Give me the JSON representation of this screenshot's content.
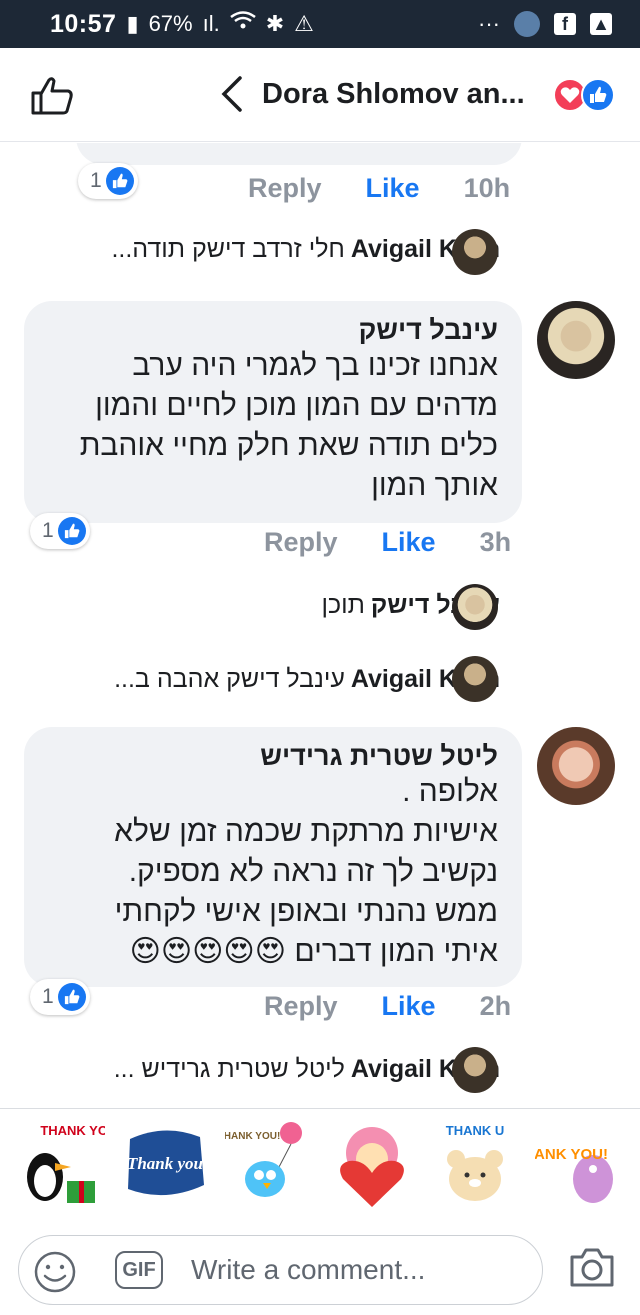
{
  "status_bar": {
    "time": "10:57",
    "battery": "67%",
    "menu_dots": "···"
  },
  "header": {
    "title": "Dora Shlomov an..."
  },
  "comments": [
    {
      "id": "top-cut",
      "reactions": "1",
      "reply": "Reply",
      "like": "Like",
      "age": "10h"
    },
    {
      "id": "c1",
      "author": "עינבל דישק",
      "text": "אנחנו  זכינו בך לגמרי היה ערב מדהים עם המון מוכן לחיים והמון כלים תודה שאת חלק מחיי אוהבת אותך המון",
      "reactions": "1",
      "reply": "Reply",
      "like": "Like",
      "age": "3h"
    },
    {
      "id": "c2",
      "author": "ליטל שטרית גרידיש",
      "text_lines": [
        "אלופה .",
        "אישיות מרתקת שכמה זמן שלא",
        "נקשיב לך זה נראה לא מספיק.",
        "ממש נהנתי ובאופן אישי לקחתי",
        "איתי המון דברים"
      ],
      "emojis": "😍😍😍😍😍",
      "reactions": "1",
      "reply": "Reply",
      "like": "Like",
      "age": "2h"
    }
  ],
  "replies": [
    {
      "author": "Avigail Klein",
      "text": "חלי זרדב דישק תודה..."
    },
    {
      "author": "עינבל דישק",
      "text": "תוכן"
    },
    {
      "author": "Avigail Klein",
      "text": "עינבל דישק אהבה ב..."
    },
    {
      "author": "Avigail Klein",
      "text": "ליטל שטרית גרידיש ..."
    }
  ],
  "stickers": [
    "THANK YOU!",
    "Thank you",
    "THANK YOU!",
    "",
    "THANK U",
    "THANK YOU!"
  ],
  "composer": {
    "gif_label": "GIF",
    "placeholder": "Write a comment..."
  },
  "colors": {
    "status_bar": "#1d2836",
    "bubble": "#f0f2f5",
    "fb_blue": "#1877f2",
    "muted": "#8d949e",
    "love_red": "#f33e58"
  }
}
